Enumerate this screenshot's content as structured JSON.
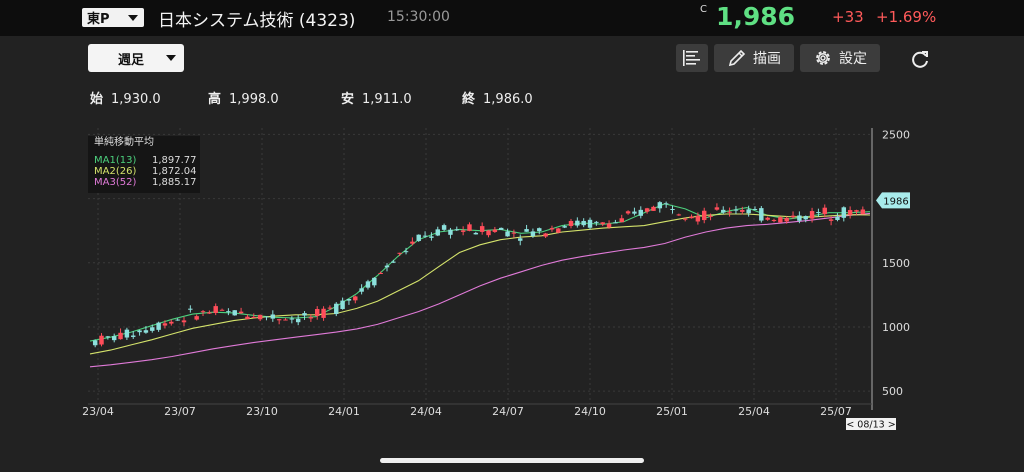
{
  "header": {
    "market": "東P",
    "stock_name": "日本システム技術 (4323)",
    "time": "15:30:00",
    "price_flag": "C",
    "price": "1,986",
    "change": "+33",
    "change_pct": "+1.69%"
  },
  "toolbar": {
    "period": "週足",
    "draw_label": "描画",
    "settings_label": "設定"
  },
  "ohlc": {
    "open_label": "始",
    "open": "1,930.0",
    "high_label": "高",
    "high": "1,998.0",
    "low_label": "安",
    "low": "1,911.0",
    "close_label": "終",
    "close": "1,986.0"
  },
  "legend": {
    "title": "単純移動平均",
    "items": [
      {
        "name": "MA1(13)",
        "value": "1,897.77",
        "color": "#4cd07d"
      },
      {
        "name": "MA2(26)",
        "value": "1,872.04",
        "color": "#d4e36b"
      },
      {
        "name": "MA3(52)",
        "value": "1,885.17",
        "color": "#e07ad8"
      }
    ]
  },
  "colors": {
    "up": "#ff4d5a",
    "down": "#8ce0dc",
    "accent_green": "#5fe083",
    "price_tag": "#a8ecec"
  },
  "chart_data": {
    "type": "candlestick",
    "title": "",
    "xlabel": "",
    "ylabel": "",
    "ylim": [
      400,
      2550
    ],
    "y_ticks": [
      "2500",
      "2000",
      "1500",
      "1000",
      "500"
    ],
    "x_ticks": [
      "23/04",
      "23/07",
      "23/10",
      "24/01",
      "24/04",
      "24/07",
      "24/10",
      "25/01",
      "25/04",
      "25/07"
    ],
    "last_price_label": "1986",
    "date_label": "< 08/13 >",
    "grid": true,
    "ma_series": [
      {
        "name": "MA1(13)",
        "values": [
          890,
          920,
          960,
          1010,
          1060,
          1100,
          1115,
          1110,
          1090,
          1075,
          1070,
          1080,
          1160,
          1260,
          1400,
          1550,
          1680,
          1740,
          1760,
          1750,
          1760,
          1730,
          1740,
          1790,
          1810,
          1800,
          1820,
          1890,
          1960,
          1920,
          1850,
          1900,
          1930,
          1870,
          1840,
          1860,
          1890,
          1890,
          1898
        ]
      },
      {
        "name": "MA2(26)",
        "values": [
          790,
          820,
          860,
          900,
          945,
          990,
          1020,
          1050,
          1070,
          1085,
          1095,
          1095,
          1105,
          1145,
          1200,
          1280,
          1360,
          1470,
          1580,
          1640,
          1680,
          1700,
          1710,
          1740,
          1755,
          1770,
          1780,
          1790,
          1820,
          1850,
          1870,
          1880,
          1880,
          1870,
          1860,
          1855,
          1865,
          1875,
          1872
        ]
      }
    ]
  }
}
